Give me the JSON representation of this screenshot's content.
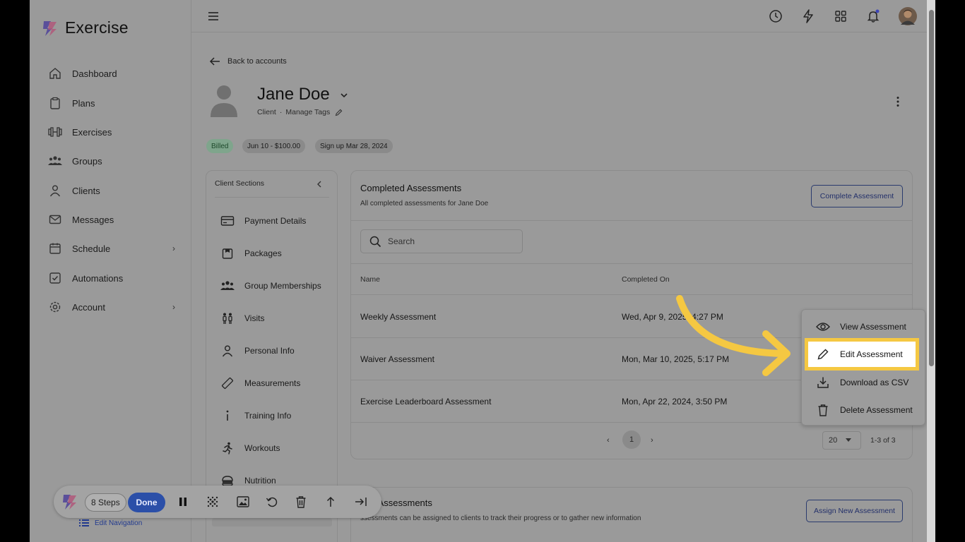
{
  "app": {
    "name": "Exercise"
  },
  "sidebar": {
    "items": [
      {
        "label": "Dashboard",
        "icon": "home-icon"
      },
      {
        "label": "Plans",
        "icon": "clipboard-icon"
      },
      {
        "label": "Exercises",
        "icon": "dumbbell-icon"
      },
      {
        "label": "Groups",
        "icon": "group-icon"
      },
      {
        "label": "Clients",
        "icon": "user-icon"
      },
      {
        "label": "Messages",
        "icon": "mail-icon"
      },
      {
        "label": "Schedule",
        "icon": "calendar-icon"
      },
      {
        "label": "Automations",
        "icon": "check-square-icon"
      },
      {
        "label": "Account",
        "icon": "gear-icon"
      }
    ]
  },
  "header": {
    "back_label": "Back to accounts"
  },
  "client": {
    "name": "Jane Doe",
    "role": "Client",
    "separator": "·",
    "manage_tags": "Manage Tags",
    "badges": [
      "Billed",
      "Jun 10 - $100.00",
      "Sign up Mar 28, 2024"
    ]
  },
  "sections": {
    "title": "Client Sections",
    "items": [
      {
        "label": "Payment Details",
        "icon": "credit-card-icon"
      },
      {
        "label": "Packages",
        "icon": "package-icon"
      },
      {
        "label": "Group Memberships",
        "icon": "group-icon"
      },
      {
        "label": "Visits",
        "icon": "visits-icon"
      },
      {
        "label": "Personal Info",
        "icon": "user-icon"
      },
      {
        "label": "Measurements",
        "icon": "ruler-icon"
      },
      {
        "label": "Training Info",
        "icon": "info-icon"
      },
      {
        "label": "Workouts",
        "icon": "running-icon"
      },
      {
        "label": "Nutrition",
        "icon": "nutrition-icon"
      }
    ]
  },
  "completed": {
    "title": "Completed Assessments",
    "subtitle": "All completed assessments for Jane Doe",
    "button": "Complete Assessment",
    "search_placeholder": "Search",
    "columns": [
      "Name",
      "Completed On"
    ],
    "rows": [
      {
        "name": "Weekly Assessment",
        "date": "Wed, Apr 9, 2025, 4:27 PM"
      },
      {
        "name": "Waiver Assessment",
        "date": "Mon, Mar 10, 2025, 5:17 PM"
      },
      {
        "name": "Exercise Leaderboard Assessment",
        "date": "Mon, Apr 22, 2024, 3:50 PM"
      }
    ],
    "page": "1",
    "per_page": "20",
    "range": "1-3 of 3"
  },
  "menu": {
    "items": [
      {
        "label": "View Assessment",
        "icon": "eye-icon"
      },
      {
        "label": "Edit Assessment",
        "icon": "pencil-icon"
      },
      {
        "label": "Download as CSV",
        "icon": "download-icon"
      },
      {
        "label": "Delete Assessment",
        "icon": "trash-icon"
      }
    ]
  },
  "assigned": {
    "title": "Assigned Assessments",
    "title_visible": "ned Assessments",
    "subtitle_visible": "ssessments can be assigned to clients to track their progress or to gather new information",
    "button": "Assign New Assessment"
  },
  "recorder": {
    "steps": "8 Steps",
    "done": "Done",
    "edit_nav": "Edit Navigation"
  },
  "colors": {
    "highlight": "#f5c842",
    "accent": "#23306a",
    "done_button": "#2b4fa8"
  }
}
